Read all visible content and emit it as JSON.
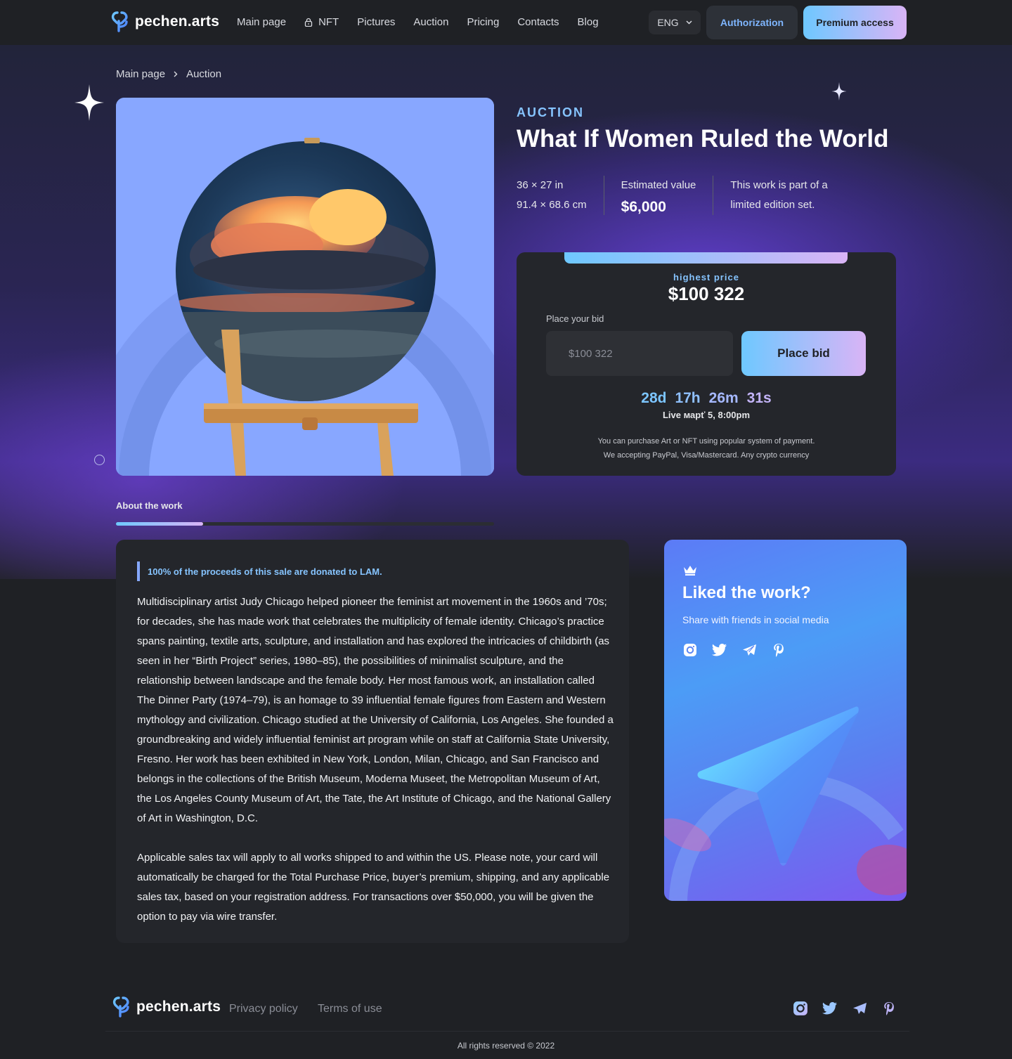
{
  "header": {
    "brand": "pechen.arts",
    "nav": [
      {
        "label": "Main page",
        "locked": false
      },
      {
        "label": "NFT",
        "locked": true
      },
      {
        "label": "Pictures",
        "locked": false
      },
      {
        "label": "Auction",
        "locked": false
      },
      {
        "label": "Pricing",
        "locked": false
      },
      {
        "label": "Contacts",
        "locked": false
      },
      {
        "label": "Blog",
        "locked": false
      }
    ],
    "language": "ENG",
    "auth_label": "Authorization",
    "premium_label": "Premium access"
  },
  "breadcrumb": {
    "home": "Main page",
    "current": "Auction"
  },
  "artwork": {
    "alt_subject": "painting-of-cloud-on-easel"
  },
  "info": {
    "section_label": "AUCTION",
    "title": "What If Women Ruled the World",
    "size_in": "36 × 27 in",
    "size_cm": "91.4 × 68.6 cm",
    "estimated_label": "Estimated value",
    "estimated_value": "$6,000",
    "edition_line1": "This work is part of a",
    "edition_line2": "limited edition set."
  },
  "bid": {
    "highest_label": "highest price",
    "highest_value": "$100 322",
    "place_label": "Place your bid",
    "input_placeholder": "$100 322",
    "button_label": "Place bid",
    "timer": {
      "days": "28d",
      "hours": "17h",
      "minutes": "26m",
      "seconds": "31s"
    },
    "live_text": "Live марť 5, 8:00pm",
    "pay_note_1": "You can purchase Art or NFT using popular system of payment.",
    "pay_note_2": "We accepting PayPal, Visa/Mastercard. Any crypto currency"
  },
  "tabs": {
    "active_label": "About the work",
    "progress": 0.23
  },
  "about": {
    "quote": "100% of the proceeds of this sale are donated to LAM.",
    "paragraph_1": "Multidisciplinary artist Judy Chicago helped pioneer the feminist art movement in the 1960s and ’70s; for decades, she has made work that celebrates the multiplicity of female identity. Chicago’s practice spans painting, textile arts, sculpture, and installation and has explored the intricacies of childbirth (as seen in her “Birth Project” series, 1980–85), the possibilities of minimalist sculpture, and the relationship between landscape and the female body. Her most famous work, an installation called The Dinner Party (1974–79), is an homage to 39 influential female figures from Eastern and Western mythology and civilization. Chicago studied at the University of California, Los Angeles. She founded a groundbreaking and widely influential feminist art program while on staff at California State University, Fresno. Her work has been exhibited in New York, London, Milan, Chicago, and San Francisco and belongs in the collections of the British Museum, Moderna Museet, the Metropolitan Museum of Art, the Los Angeles County Museum of Art, the Tate, the Art Institute of Chicago, and the National Gallery of Art in Washington, D.C.",
    "paragraph_2": "Applicable sales tax will apply to all works shipped to and within the US. Please note, your card will automatically be charged for the Total Purchase Price, buyer’s premium, shipping, and any applicable sales tax, based on your registration address. For transactions over $50,000, you will be given the option to pay via wire transfer."
  },
  "share": {
    "title": "Liked the work?",
    "subtitle": "Share with friends in social media",
    "icons": [
      "instagram-icon",
      "twitter-icon",
      "telegram-icon",
      "pinterest-icon"
    ]
  },
  "footer": {
    "brand": "pechen.arts",
    "privacy": "Privacy policy",
    "terms": "Terms of use",
    "copyright": "All rights reserved © 2022"
  },
  "colors": {
    "accent_blue": "#86c4ff",
    "gradient_start": "#6ec8ff",
    "gradient_end": "#d9b4f6",
    "background": "#1f2125",
    "card": "#24262b"
  }
}
